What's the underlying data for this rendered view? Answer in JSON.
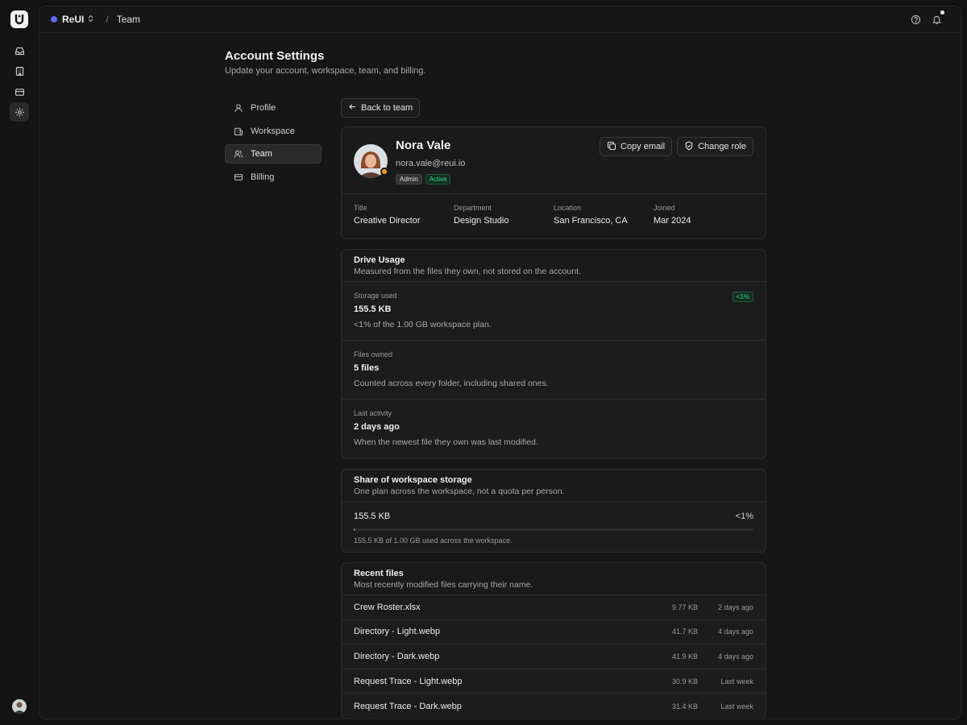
{
  "topbar": {
    "workspace": "ReUI",
    "separator": "/",
    "crumb": "Team"
  },
  "header": {
    "title": "Account Settings",
    "subtitle": "Update your account, workspace, team, and billing."
  },
  "nav": {
    "items": [
      {
        "label": "Profile",
        "icon": "user-icon"
      },
      {
        "label": "Workspace",
        "icon": "building-icon"
      },
      {
        "label": "Team",
        "icon": "users-icon",
        "active": true
      },
      {
        "label": "Billing",
        "icon": "credit-card-icon"
      }
    ]
  },
  "back_label": "Back to team",
  "member": {
    "name": "Nora Vale",
    "email": "nora.vale@reui.io",
    "role_badge": "Admin",
    "status_badge": "Active",
    "copy_email_label": "Copy email",
    "change_role_label": "Change role",
    "facts": [
      {
        "label": "Title",
        "value": "Creative Director"
      },
      {
        "label": "Department",
        "value": "Design Studio"
      },
      {
        "label": "Location",
        "value": "San Francisco, CA"
      },
      {
        "label": "Joined",
        "value": "Mar 2024"
      }
    ]
  },
  "drive": {
    "title": "Drive Usage",
    "subtitle": "Measured from the files they own, not stored on the account.",
    "metrics": [
      {
        "label": "Storage used",
        "value": "155.5 KB",
        "desc": "<1% of the 1.00 GB workspace plan.",
        "pill": "<1%"
      },
      {
        "label": "Files owned",
        "value": "5 files",
        "desc": "Counted across every folder, including shared ones."
      },
      {
        "label": "Last activity",
        "value": "2 days ago",
        "desc": "When the newest file they own was last modified."
      }
    ]
  },
  "share": {
    "title": "Share of workspace storage",
    "subtitle": "One plan across the workspace, not a quota per person.",
    "value": "155.5 KB",
    "percent": "<1%",
    "fraction": 0.0002,
    "note": "155.5 KB of 1.00 GB used across the workspace."
  },
  "recent": {
    "title": "Recent files",
    "subtitle": "Most recently modified files carrying their name.",
    "files": [
      {
        "name": "Crew Roster.xlsx",
        "size": "9.77 KB",
        "when": "2 days ago"
      },
      {
        "name": "Directory - Light.webp",
        "size": "41.7 KB",
        "when": "4 days ago"
      },
      {
        "name": "Directory - Dark.webp",
        "size": "41.9 KB",
        "when": "4 days ago"
      },
      {
        "name": "Request Trace - Light.webp",
        "size": "30.9 KB",
        "when": "Last week"
      },
      {
        "name": "Request Trace - Dark.webp",
        "size": "31.4 KB",
        "when": "Last week"
      }
    ]
  }
}
